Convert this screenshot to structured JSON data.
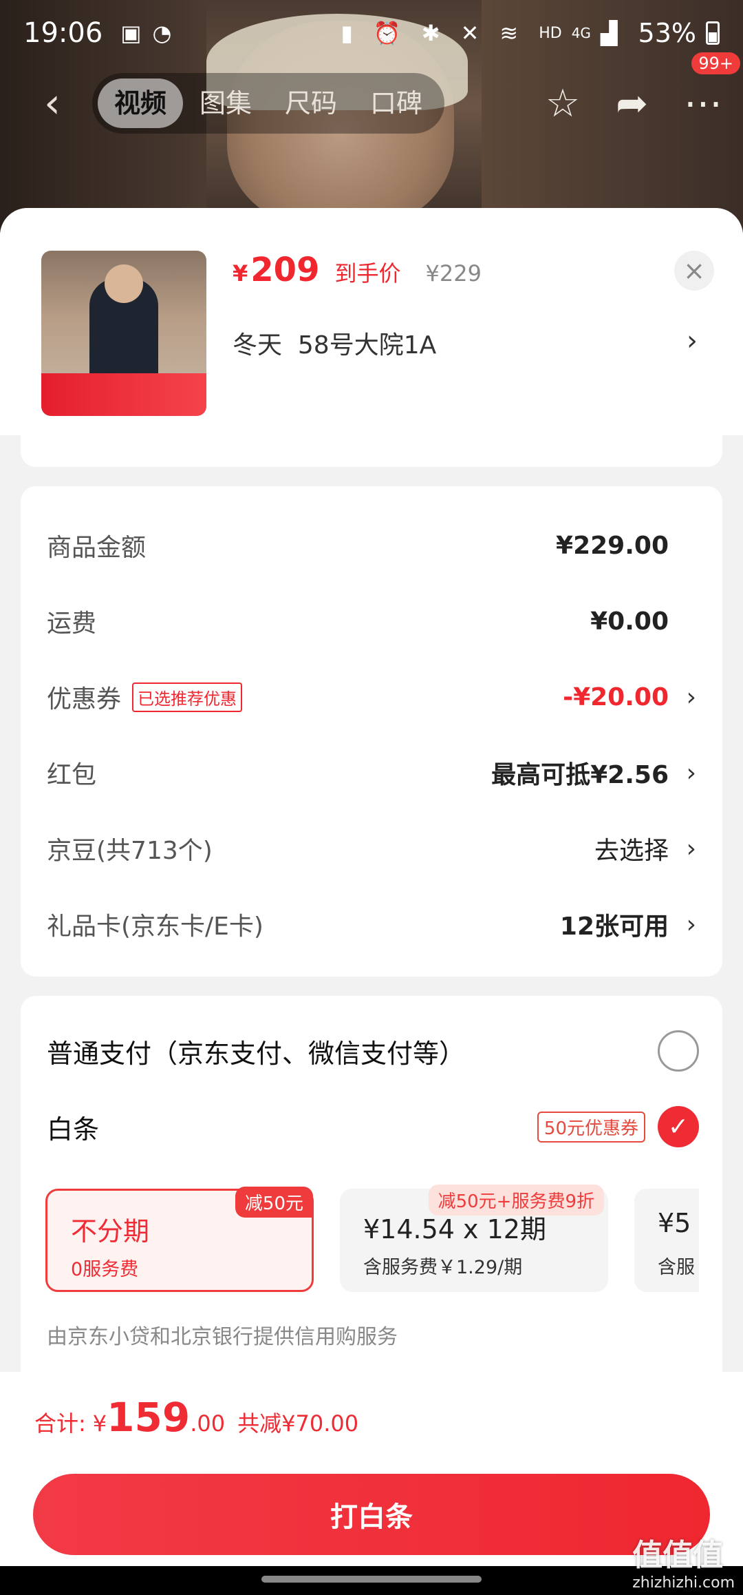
{
  "status_bar": {
    "time": "19:06",
    "network": "HD",
    "signal": "4G",
    "battery_percent": "53%"
  },
  "nav": {
    "tabs": [
      "视频",
      "图集",
      "尺码",
      "口碑"
    ],
    "active_tab": 0,
    "more_badge": "99+"
  },
  "product": {
    "price_symbol": "¥",
    "price": "209",
    "price_label": "到手价",
    "original_price": "¥229",
    "spec": "冬天  58号大院1A",
    "close_icon": "close-icon"
  },
  "costs": [
    {
      "label": "商品金额",
      "value": "¥229.00",
      "tag": "",
      "arrow": false,
      "style": "bold"
    },
    {
      "label": "运费",
      "value": "¥0.00",
      "tag": "",
      "arrow": false,
      "style": "bold"
    },
    {
      "label": "优惠券",
      "value": "-¥20.00",
      "tag": "已选推荐优惠",
      "arrow": true,
      "style": "red"
    },
    {
      "label": "红包",
      "value": "最高可抵¥2.56",
      "tag": "",
      "arrow": true,
      "style": "bold"
    },
    {
      "label": "京豆(共713个)",
      "value": "去选择",
      "tag": "",
      "arrow": true,
      "style": "plain"
    },
    {
      "label": "礼品卡(京东卡/E卡)",
      "value": "12张可用",
      "tag": "",
      "arrow": true,
      "style": "bold"
    }
  ],
  "payment": {
    "normal_label": "普通支付（京东支付、微信支付等）",
    "baitiao_label": "白条",
    "baitiao_coupon": "50元优惠券",
    "plans": [
      {
        "title": "不分期",
        "sub": "0服务费",
        "ribbon": "减50元",
        "selected": true
      },
      {
        "title": "¥14.54 x 12期",
        "sub": "含服务费￥1.29/期",
        "ribbon": "减50元+服务费9折",
        "selected": false
      },
      {
        "title": "¥5",
        "sub": "含服",
        "ribbon": "",
        "selected": false
      }
    ],
    "credit_note": "由京东小贷和北京银行提供信用购服务"
  },
  "summary": {
    "label": "合计:",
    "yen": "¥",
    "amount_int": "159",
    "amount_dec": ".00",
    "saved": "共减¥70.00"
  },
  "cta": {
    "label": "打白条"
  },
  "watermark": {
    "main": "值值值",
    "sub": "zhizhizhi.com"
  },
  "colors": {
    "accent": "#ef2b34",
    "sheet_bg": "#f2f2f2"
  }
}
